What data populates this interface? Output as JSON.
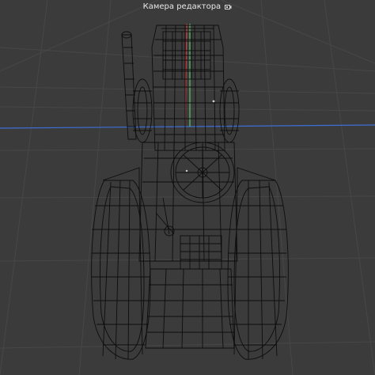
{
  "viewport": {
    "camera_label": "Камера редактора",
    "camera_icon": "camera-icon",
    "background_color": "#3b3b3b",
    "grid_color": "#4a4a4a",
    "wire_color": "#0d0d0d",
    "axis_x_color": "#3d6fd8",
    "axis_y_color": "#5cc26b",
    "axis_z_color": "#d83d3d"
  }
}
